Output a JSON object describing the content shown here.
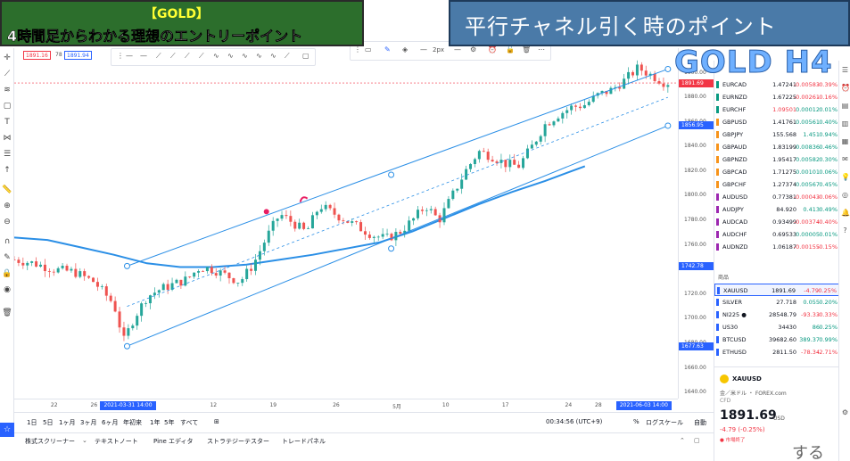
{
  "overlay": {
    "gold_tag": "【GOLD】",
    "subtitle": "4時間足からわかる理想のエントリーポイント",
    "caption": "平行チャネル引く時のポイント",
    "h4_label": "GOLD H4",
    "bottom_text": "する"
  },
  "header_prices": {
    "sell": "1891.16",
    "spread": "78",
    "buy": "1891.94"
  },
  "price_axis": {
    "ticks": [
      "1900.00",
      "1880.00",
      "1860.00",
      "1840.00",
      "1820.00",
      "1800.00",
      "1780.00",
      "1760.00",
      "1740.00",
      "1720.00",
      "1700.00",
      "1680.00",
      "1660.00",
      "1640.00"
    ],
    "tags": [
      {
        "label": "1891.69",
        "color": "#f23645"
      },
      {
        "label": "1856.95",
        "color": "#2962ff"
      },
      {
        "label": "1742.78",
        "color": "#2962ff"
      },
      {
        "label": "1677.63",
        "color": "#2962ff"
      }
    ]
  },
  "time_axis": {
    "ticks": [
      "22",
      "26",
      "12",
      "19",
      "26",
      "5月",
      "10",
      "17",
      "24",
      "28"
    ],
    "tag_start": "2021-03-31  14:00",
    "tag_end": "2021-06-03  14:00"
  },
  "range_bar": {
    "ranges": [
      "1日",
      "5日",
      "1ヶ月",
      "3ヶ月",
      "6ヶ月",
      "年初来",
      "1年",
      "5年",
      "すべて"
    ],
    "clock": "00:34:56 (UTC+9)",
    "pct": "%",
    "log": "ログスケール",
    "auto": "自動"
  },
  "bottom_tabs": [
    "株式スクリーナー",
    "テキストノート",
    "Pine エディタ",
    "ストラテジーテスター",
    "トレードパネル"
  ],
  "draw_toolbar": {
    "width_label": "2px"
  },
  "watchlist": {
    "rows": [
      {
        "sym": "EURCAD",
        "last": "1.47241",
        "chg": "-0.00583",
        "pct": "-0.39%",
        "flag": "#089981",
        "dir": "neg"
      },
      {
        "sym": "EURNZD",
        "last": "1.67225",
        "chg": "-0.00261",
        "pct": "-0.16%",
        "flag": "#089981",
        "dir": "neg"
      },
      {
        "sym": "EURCHF",
        "last": "1.09501",
        "chg": "0.00012",
        "pct": "0.01%",
        "flag": "#089981",
        "dir": "pos"
      },
      {
        "sym": "GBPUSD",
        "last": "1.41761",
        "chg": "0.00561",
        "pct": "0.40%",
        "flag": "#f7931a",
        "dir": "pos"
      },
      {
        "sym": "GBPJPY",
        "last": "155.568",
        "chg": "1.451",
        "pct": "0.94%",
        "flag": "#f7931a",
        "dir": "pos"
      },
      {
        "sym": "GBPAUD",
        "last": "1.83199",
        "chg": "0.00836",
        "pct": "0.46%",
        "flag": "#f7931a",
        "dir": "pos"
      },
      {
        "sym": "GBPNZD",
        "last": "1.95417",
        "chg": "0.00582",
        "pct": "0.30%",
        "flag": "#f7931a",
        "dir": "pos"
      },
      {
        "sym": "GBPCAD",
        "last": "1.71275",
        "chg": "0.00101",
        "pct": "0.06%",
        "flag": "#f7931a",
        "dir": "pos"
      },
      {
        "sym": "GBPCHF",
        "last": "1.27374",
        "chg": "0.00567",
        "pct": "0.45%",
        "flag": "#f7931a",
        "dir": "pos"
      },
      {
        "sym": "AUDUSD",
        "last": "0.77381",
        "chg": "-0.00043",
        "pct": "-0.06%",
        "flag": "#9c27b0",
        "dir": "neg"
      },
      {
        "sym": "AUDJPY",
        "last": "84.920",
        "chg": "0.413",
        "pct": "0.49%",
        "flag": "#9c27b0",
        "dir": "pos"
      },
      {
        "sym": "AUDCAD",
        "last": "0.93499",
        "chg": "-0.00374",
        "pct": "-0.40%",
        "flag": "#9c27b0",
        "dir": "neg"
      },
      {
        "sym": "AUDCHF",
        "last": "0.69533",
        "chg": "0.00005",
        "pct": "0.01%",
        "flag": "#9c27b0",
        "dir": "pos"
      },
      {
        "sym": "AUDNZD",
        "last": "1.06187",
        "chg": "-0.00155",
        "pct": "-0.15%",
        "flag": "#9c27b0",
        "dir": "neg"
      }
    ],
    "section_label": "商品",
    "rows2": [
      {
        "sym": "XAUUSD",
        "last": "1891.69",
        "chg": "-4.79",
        "pct": "-0.25%",
        "flag": "#2962ff",
        "dir": "neg"
      },
      {
        "sym": "SILVER",
        "last": "27.718",
        "chg": "0.055",
        "pct": "0.20%",
        "flag": "#2962ff",
        "dir": "pos"
      },
      {
        "sym": "NI225 ●",
        "last": "28548.79",
        "chg": "-93.33",
        "pct": "-0.33%",
        "flag": "#2962ff",
        "dir": "neg"
      },
      {
        "sym": "US30",
        "last": "34430",
        "chg": "86",
        "pct": "0.25%",
        "flag": "#2962ff",
        "dir": "pos"
      },
      {
        "sym": "BTCUSD",
        "last": "39682.60",
        "chg": "389.37",
        "pct": "0.99%",
        "flag": "#2962ff",
        "dir": "pos"
      },
      {
        "sym": "ETHUSD",
        "last": "2811.50",
        "chg": "-78.34",
        "pct": "-2.71%",
        "flag": "#2962ff",
        "dir": "neg"
      }
    ],
    "detail": {
      "symbol": "XAUUSD",
      "description": "金／米ドル ・ FOREX.com",
      "type": "CFD",
      "price": "1891.69",
      "currency": "USD",
      "change": "-4.79 (-0.25%)",
      "status": "● 市場終了"
    }
  },
  "chart_data": {
    "type": "line",
    "ylim": [
      1635,
      1920
    ],
    "price_line": 1891.69,
    "channel": {
      "upper": [
        [
          0.17,
          1742.78
        ],
        [
          0.985,
          1903
        ]
      ],
      "lower": [
        [
          0.17,
          1677.63
        ],
        [
          0.985,
          1856.95
        ]
      ],
      "mid_dashed": [
        [
          0.17,
          1710
        ],
        [
          0.985,
          1880
        ]
      ]
    },
    "ma": [
      [
        0,
        1766
      ],
      [
        0.05,
        1764
      ],
      [
        0.1,
        1758
      ],
      [
        0.15,
        1752
      ],
      [
        0.2,
        1745
      ],
      [
        0.25,
        1742
      ],
      [
        0.3,
        1742
      ],
      [
        0.35,
        1744
      ],
      [
        0.4,
        1748
      ],
      [
        0.45,
        1752
      ],
      [
        0.5,
        1757
      ],
      [
        0.55,
        1762
      ],
      [
        0.6,
        1771
      ],
      [
        0.65,
        1782
      ],
      [
        0.7,
        1793
      ],
      [
        0.75,
        1803
      ],
      [
        0.8,
        1812
      ],
      [
        0.86,
        1824
      ]
    ],
    "close": [
      [
        0.0,
        1748
      ],
      [
        0.03,
        1745
      ],
      [
        0.06,
        1740
      ],
      [
        0.09,
        1738
      ],
      [
        0.12,
        1730
      ],
      [
        0.15,
        1712
      ],
      [
        0.165,
        1682
      ],
      [
        0.18,
        1700
      ],
      [
        0.2,
        1718
      ],
      [
        0.22,
        1724
      ],
      [
        0.24,
        1728
      ],
      [
        0.26,
        1732
      ],
      [
        0.28,
        1742
      ],
      [
        0.3,
        1740
      ],
      [
        0.32,
        1735
      ],
      [
        0.34,
        1730
      ],
      [
        0.36,
        1744
      ],
      [
        0.38,
        1766
      ],
      [
        0.4,
        1785
      ],
      [
        0.42,
        1778
      ],
      [
        0.44,
        1770
      ],
      [
        0.46,
        1792
      ],
      [
        0.48,
        1786
      ],
      [
        0.5,
        1780
      ],
      [
        0.52,
        1774
      ],
      [
        0.54,
        1768
      ],
      [
        0.56,
        1765
      ],
      [
        0.58,
        1770
      ],
      [
        0.6,
        1780
      ],
      [
        0.62,
        1792
      ],
      [
        0.64,
        1780
      ],
      [
        0.66,
        1800
      ],
      [
        0.68,
        1820
      ],
      [
        0.7,
        1836
      ],
      [
        0.72,
        1832
      ],
      [
        0.74,
        1826
      ],
      [
        0.76,
        1824
      ],
      [
        0.78,
        1840
      ],
      [
        0.8,
        1858
      ],
      [
        0.82,
        1866
      ],
      [
        0.84,
        1872
      ],
      [
        0.86,
        1874
      ],
      [
        0.88,
        1882
      ],
      [
        0.9,
        1886
      ],
      [
        0.92,
        1894
      ],
      [
        0.94,
        1904
      ],
      [
        0.96,
        1898
      ],
      [
        0.98,
        1892
      ]
    ]
  }
}
